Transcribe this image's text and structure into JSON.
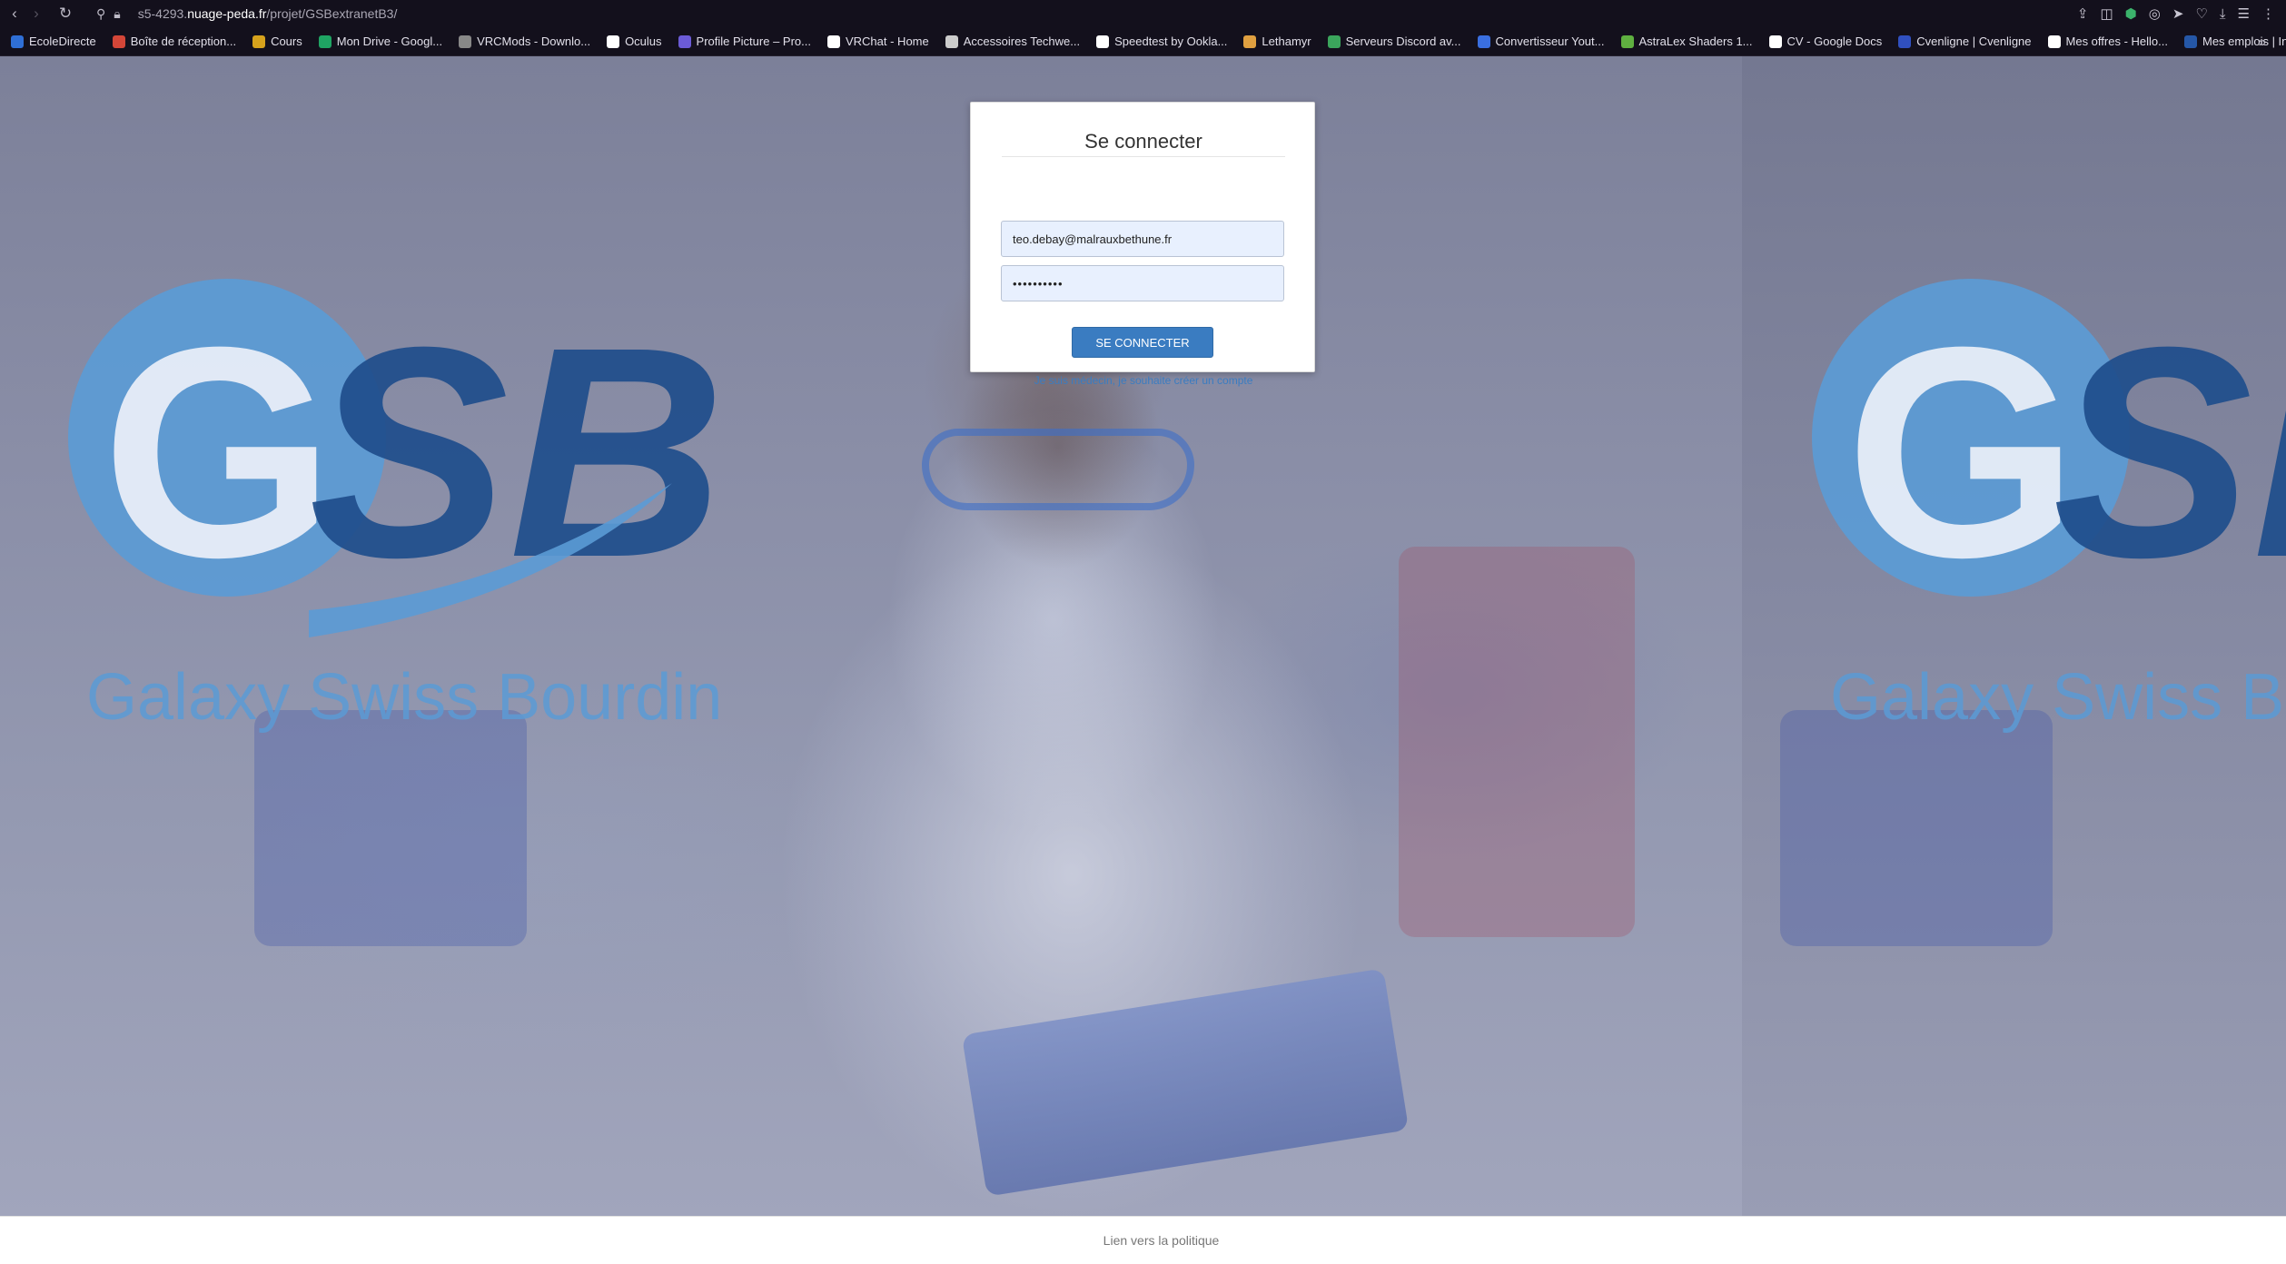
{
  "browser": {
    "url_host_prefix": "s5-4293.",
    "url_domain": "nuage-peda.fr",
    "url_path": "/projet/GSBextranetB3/"
  },
  "bookmarks": [
    {
      "label": "EcoleDirecte",
      "icon": "ecoledirecte-icon",
      "color": "#2f6fd6"
    },
    {
      "label": "Boîte de réception...",
      "icon": "gmail-icon",
      "color": "#d44638"
    },
    {
      "label": "Cours",
      "icon": "folder-icon",
      "color": "#d6a21c"
    },
    {
      "label": "Mon Drive - Googl...",
      "icon": "google-drive-icon",
      "color": "#1fa463"
    },
    {
      "label": "VRCMods - Downlo...",
      "icon": "vrcmods-icon",
      "color": "#888888"
    },
    {
      "label": "Oculus",
      "icon": "oculus-icon",
      "color": "#ffffff"
    },
    {
      "label": "Profile Picture – Pro...",
      "icon": "profile-picture-icon",
      "color": "#6b5bd6"
    },
    {
      "label": "VRChat - Home",
      "icon": "vrchat-icon",
      "color": "#ffffff"
    },
    {
      "label": "Accessoires Techwe...",
      "icon": "techwear-icon",
      "color": "#cccccc"
    },
    {
      "label": "Speedtest by Ookla...",
      "icon": "speedtest-icon",
      "color": "#ffffff"
    },
    {
      "label": "Lethamyr",
      "icon": "lethamyr-icon",
      "color": "#e0a040"
    },
    {
      "label": "Serveurs Discord av...",
      "icon": "discord-servers-icon",
      "color": "#3ba55c"
    },
    {
      "label": "Convertisseur Yout...",
      "icon": "converter-icon",
      "color": "#3a6fe0"
    },
    {
      "label": "AstraLex Shaders 1...",
      "icon": "astralex-icon",
      "color": "#5fb040"
    },
    {
      "label": "CV - Google Docs",
      "icon": "google-icon",
      "color": "#ffffff"
    },
    {
      "label": "Cvenligne | Cvenligne",
      "icon": "cvenligne-icon",
      "color": "#3050c0"
    },
    {
      "label": "Mes offres - Hello...",
      "icon": "hellowork-icon",
      "color": "#ffffff"
    },
    {
      "label": "Mes emplois | Indeed",
      "icon": "indeed-icon",
      "color": "#2557a7"
    }
  ],
  "brand": {
    "logo_letters": "GSB",
    "logo_tagline": "Galaxy Swiss Bourdin",
    "light_blue": "#5b9bd5",
    "dark_blue": "#1f4e8c"
  },
  "login": {
    "title": "Se connecter",
    "email_value": "teo.debay@malrauxbethune.fr",
    "password_value": "••••••••••",
    "submit_label": "SE CONNECTER",
    "create_account_link": "Je suis médecin, je souhaite créer un compte",
    "accent": "#3a7cc1"
  },
  "footer": {
    "policy_link": "Lien vers la politique"
  }
}
